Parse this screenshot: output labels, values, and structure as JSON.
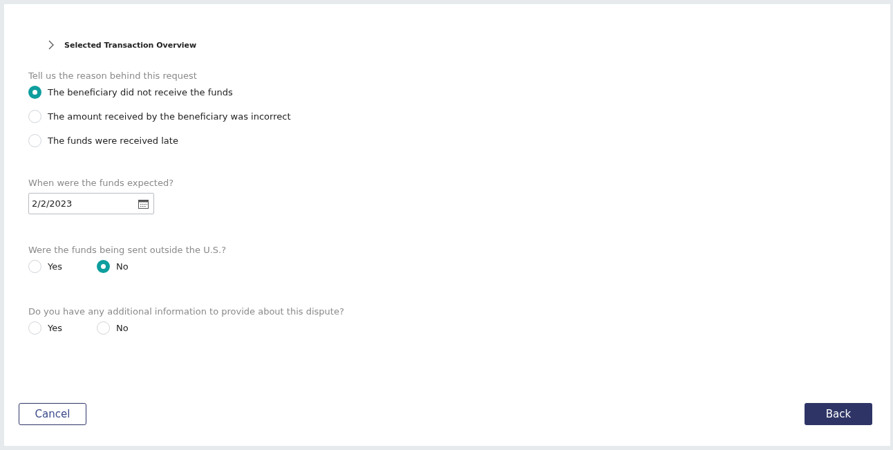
{
  "section": {
    "title": "Selected Transaction Overview",
    "expanded": false
  },
  "questions": [
    {
      "kind": "radio-list",
      "label": "Tell us the reason behind this request",
      "options": [
        {
          "label": "The beneficiary did not receive the funds",
          "selected": true
        },
        {
          "label": "The amount received by the beneficiary was incorrect",
          "selected": false
        },
        {
          "label": "The funds were received late",
          "selected": false
        }
      ]
    },
    {
      "kind": "date",
      "label": "When were the funds expected?",
      "value": "2/2/2023"
    },
    {
      "kind": "radio-row",
      "label": "Were the funds being sent outside the U.S.?",
      "options": [
        {
          "label": "Yes",
          "selected": false
        },
        {
          "label": "No",
          "selected": true
        }
      ]
    },
    {
      "kind": "radio-row",
      "label": "Do you have any additional information to provide about this dispute?",
      "options": [
        {
          "label": "Yes",
          "selected": false
        },
        {
          "label": "No",
          "selected": false
        }
      ]
    }
  ],
  "buttons": [
    {
      "kind": "secondary",
      "label": "Cancel"
    },
    {
      "kind": "primary",
      "label": "Back"
    }
  ]
}
